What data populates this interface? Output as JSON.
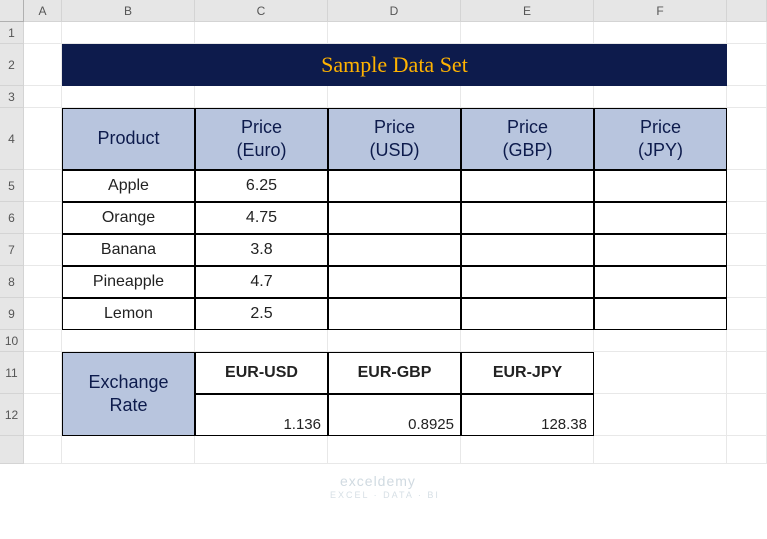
{
  "columns": [
    "A",
    "B",
    "C",
    "D",
    "E",
    "F"
  ],
  "rows": [
    "1",
    "2",
    "3",
    "4",
    "5",
    "6",
    "7",
    "8",
    "9",
    "10",
    "11",
    "12"
  ],
  "title": "Sample Data Set",
  "headers": {
    "product": "Product",
    "price_eur": "Price\n(Euro)",
    "price_usd": "Price\n(USD)",
    "price_gbp": "Price\n(GBP)",
    "price_jpy": "Price\n(JPY)"
  },
  "products": [
    {
      "name": "Apple",
      "eur": "6.25",
      "usd": "",
      "gbp": "",
      "jpy": ""
    },
    {
      "name": "Orange",
      "eur": "4.75",
      "usd": "",
      "gbp": "",
      "jpy": ""
    },
    {
      "name": "Banana",
      "eur": "3.8",
      "usd": "",
      "gbp": "",
      "jpy": ""
    },
    {
      "name": "Pineapple",
      "eur": "4.7",
      "usd": "",
      "gbp": "",
      "jpy": ""
    },
    {
      "name": "Lemon",
      "eur": "2.5",
      "usd": "",
      "gbp": "",
      "jpy": ""
    }
  ],
  "exchange": {
    "label": "Exchange\nRate",
    "pairs": [
      {
        "name": "EUR-USD",
        "value": "1.136"
      },
      {
        "name": "EUR-GBP",
        "value": "0.8925"
      },
      {
        "name": "EUR-JPY",
        "value": "128.38"
      }
    ]
  },
  "watermark": {
    "main": "exceldemy",
    "sub": "EXCEL · DATA · BI"
  },
  "chart_data": {
    "type": "table",
    "title": "Sample Data Set",
    "products_table": {
      "columns": [
        "Product",
        "Price (Euro)",
        "Price (USD)",
        "Price (GBP)",
        "Price (JPY)"
      ],
      "rows": [
        [
          "Apple",
          6.25,
          null,
          null,
          null
        ],
        [
          "Orange",
          4.75,
          null,
          null,
          null
        ],
        [
          "Banana",
          3.8,
          null,
          null,
          null
        ],
        [
          "Pineapple",
          4.7,
          null,
          null,
          null
        ],
        [
          "Lemon",
          2.5,
          null,
          null,
          null
        ]
      ]
    },
    "exchange_table": {
      "columns": [
        "EUR-USD",
        "EUR-GBP",
        "EUR-JPY"
      ],
      "rows": [
        [
          1.136,
          0.8925,
          128.38
        ]
      ]
    }
  }
}
